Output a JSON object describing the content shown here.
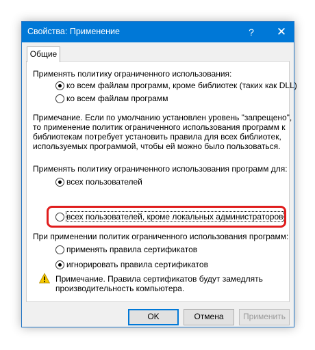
{
  "window": {
    "title": "Свойства: Применение",
    "help": "?",
    "close": "✕"
  },
  "tabs": [
    {
      "label": "Общие"
    }
  ],
  "policy": {
    "heading": "Применять политику ограниченного использования:",
    "options": [
      {
        "label": "ко всем файлам программ, кроме библиотек (таких как DLL)",
        "checked": true
      },
      {
        "label": "ко всем файлам программ",
        "checked": false
      }
    ],
    "note_lines": [
      "Примечание. Если по умолчанию установлен уровень \"запрещено\",",
      "то применение политик ограниченного использования программ к",
      "библиотекам потребует установить правила для всех библиотек,",
      "используемых  программой, чтобы ей можно было пользоваться."
    ]
  },
  "users": {
    "heading": "Применять политику ограниченного использования программ для:",
    "options": [
      {
        "label": "всех пользователей",
        "checked": true
      },
      {
        "label": "всех пользователей, кроме локальных администраторов",
        "checked": false
      }
    ]
  },
  "certs": {
    "heading": "При применении политик ограниченного использования программ:",
    "options": [
      {
        "label": "применять правила сертификатов",
        "checked": false
      },
      {
        "label": "игнорировать правила сертификатов",
        "checked": true
      }
    ]
  },
  "warning": {
    "icon": "warning-icon",
    "lines": [
      "Примечание. Правила сертификатов будут замедлять",
      "производительность компьютера."
    ]
  },
  "buttons": {
    "ok": "OK",
    "cancel": "Отмена",
    "apply": "Применить"
  },
  "colors": {
    "titlebar": "#0078d7",
    "highlight": "#e01d1d"
  }
}
